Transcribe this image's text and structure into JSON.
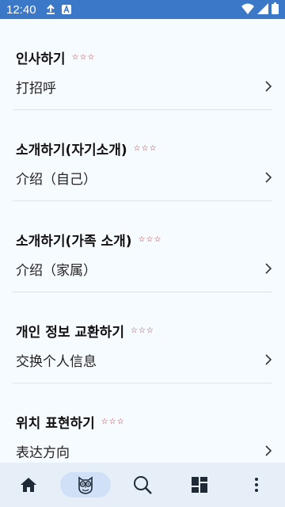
{
  "status_bar": {
    "time": "12:40",
    "icons": [
      "download-icon",
      "a-badge-icon",
      "wifi-icon",
      "cellular-icon",
      "battery-icon"
    ],
    "background": "#3c78c8"
  },
  "sections": [
    {
      "title": "인사하기",
      "stars": [
        "☆",
        "☆",
        "☆"
      ],
      "item": "打招呼"
    },
    {
      "title": "소개하기(자기소개)",
      "stars": [
        "☆",
        "☆",
        "☆"
      ],
      "item": "介绍（自己）"
    },
    {
      "title": "소개하기(가족 소개)",
      "stars": [
        "☆",
        "☆",
        "☆"
      ],
      "item": "介绍（家属）"
    },
    {
      "title": "개인 정보 교환하기",
      "stars": [
        "☆",
        "☆",
        "☆"
      ],
      "item": "交换个人信息"
    },
    {
      "title": "위치 표현하기",
      "stars": [
        "☆",
        "☆",
        "☆"
      ],
      "item": "表达方向"
    }
  ],
  "bottom_nav": {
    "items": [
      "home-icon",
      "owl-icon",
      "search-icon",
      "dashboard-icon",
      "more-vert-icon"
    ],
    "active": "owl-icon",
    "background": "#e6eef8",
    "active_pill": "#cfe0f7"
  },
  "colors": {
    "star": "#b03030",
    "page_background": "#f6fbff"
  }
}
